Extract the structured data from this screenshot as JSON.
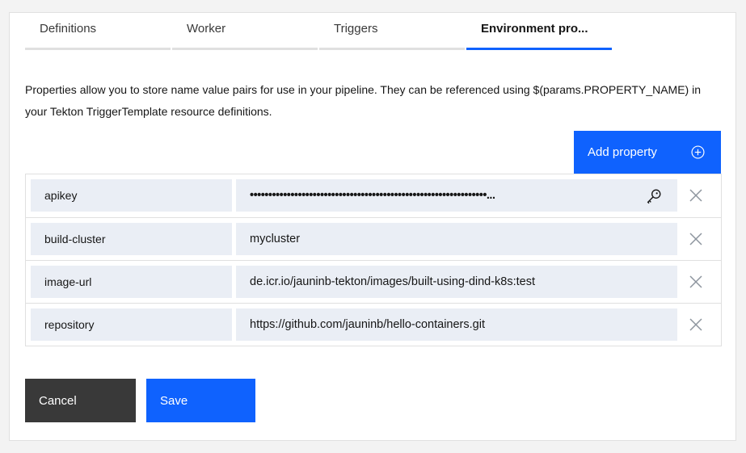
{
  "tabs": [
    {
      "label": "Definitions",
      "active": false
    },
    {
      "label": "Worker",
      "active": false
    },
    {
      "label": "Triggers",
      "active": false
    },
    {
      "label": "Environment pro...",
      "active": true
    }
  ],
  "description": "Properties allow you to store name value pairs for use in your pipeline. They can be referenced using $(params.PROPERTY_NAME) in your Tekton TriggerTemplate resource definitions.",
  "add_property": {
    "label": "Add property",
    "icon": "add-circle-icon"
  },
  "properties": [
    {
      "name": "apikey",
      "value": "••••••••••••••••••••••••••••••••••••••••••••••••••••••••••••••••...",
      "secure": true,
      "secure_icon": "key-icon",
      "delete_icon": "close-icon"
    },
    {
      "name": "build-cluster",
      "value": "mycluster",
      "secure": false,
      "delete_icon": "close-icon"
    },
    {
      "name": "image-url",
      "value": "de.icr.io/jauninb-tekton/images/built-using-dind-k8s:test",
      "secure": false,
      "delete_icon": "close-icon"
    },
    {
      "name": "repository",
      "value": "https://github.com/jauninb/hello-containers.git",
      "secure": false,
      "delete_icon": "close-icon"
    }
  ],
  "actions": {
    "cancel_label": "Cancel",
    "save_label": "Save"
  },
  "colors": {
    "primary": "#0f62fe",
    "secondary": "#393939",
    "field_bg": "#eaeef5",
    "tab_inactive_bar": "#e0e0e0"
  }
}
